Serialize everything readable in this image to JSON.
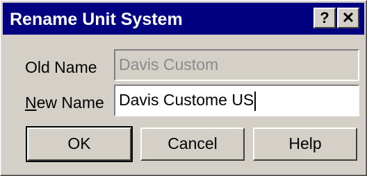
{
  "window": {
    "title": "Rename Unit System",
    "help_glyph": "?",
    "close_glyph": "✕"
  },
  "form": {
    "old_name_label": "Old Name",
    "old_name_value": "Davis Custom",
    "new_name_label_mnemonic": "N",
    "new_name_label_rest": "ew Name",
    "new_name_value": "Davis Custome US"
  },
  "buttons": {
    "ok": "OK",
    "cancel": "Cancel",
    "help": "Help"
  },
  "colors": {
    "titlebar": "#000080",
    "face": "#d4d0c8"
  }
}
